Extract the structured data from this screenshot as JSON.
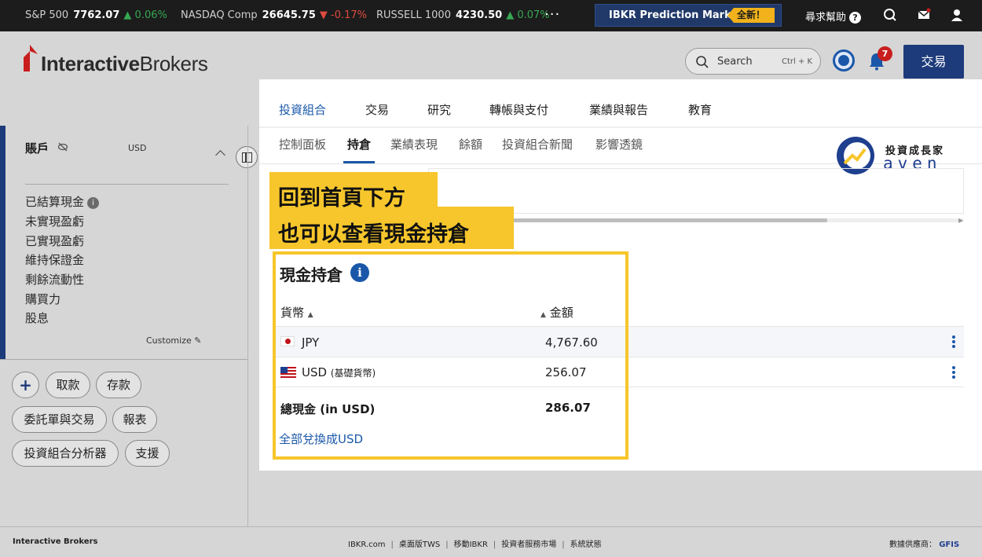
{
  "ticker": {
    "items": [
      {
        "name": "S&P 500",
        "value": "7762.07",
        "change": "0.06%",
        "dir": "up"
      },
      {
        "name": "NASDAQ Comp",
        "value": "26645.75",
        "change": "-0.17%",
        "dir": "down"
      },
      {
        "name": "RUSSELL 1000",
        "value": "4230.50",
        "change": "0.07%",
        "dir": "up"
      }
    ],
    "more": "···",
    "promo_label": "IBKR Prediction Markets",
    "promo_badge": "全新！",
    "help_label": "尋求幫助",
    "help_icon": "?"
  },
  "header": {
    "logo_bold": "Interactive",
    "logo_rest": "Brokers",
    "search_label": "Search",
    "search_hint": "Ctrl + K",
    "notification_count": "7",
    "trade_button": "交易"
  },
  "account": {
    "title": "賬戶",
    "currency": "USD",
    "items": [
      "已結算現金",
      "未實現盈虧",
      "已實現盈虧",
      "維持保證金",
      "剩餘流動性",
      "購買力",
      "股息"
    ],
    "info_icon": "i",
    "customize": "Customize"
  },
  "actions": {
    "add": "+",
    "withdraw": "取款",
    "deposit": "存款",
    "orders": "委託單與交易",
    "reports": "報表",
    "analyzer": "投資組合分析器",
    "support": "支援"
  },
  "nav": {
    "main": [
      "投資組合",
      "交易",
      "研究",
      "轉帳與支付",
      "業績與報告",
      "教育"
    ],
    "sub": [
      "控制面板",
      "持倉",
      "業績表現",
      "餘額",
      "投資組合新聞",
      "影響透鏡"
    ]
  },
  "watermark": {
    "zh": "投資成長家",
    "en": "aven"
  },
  "callout": {
    "line1": "回到首頁下方",
    "line2": "也可以查看現金持倉"
  },
  "cash": {
    "title": "現金持倉",
    "info_icon": "i",
    "col_currency": "貨幣",
    "col_amount": "金額",
    "rows": [
      {
        "currency": "JPY",
        "note": "",
        "amount": "4,767.60"
      },
      {
        "currency": "USD",
        "note": "(基礎貨幣)",
        "amount": "256.07"
      }
    ],
    "total_label": "總現金 (in USD)",
    "total_value": "286.07",
    "convert_link": "全部兌換成USD"
  },
  "footer": {
    "left": "Interactive Brokers",
    "links": [
      "IBKR.com",
      "桌面版TWS",
      "移動IBKR",
      "投資者服務市場",
      "系統狀態"
    ],
    "sep": "|",
    "provider_label": "數據供應商：",
    "provider": "GFIS"
  },
  "colors": {
    "accent": "#1a57a8",
    "navy": "#1d3b7a",
    "highlight": "#f6c62c",
    "up": "#36a852",
    "down": "#e04b3f"
  }
}
